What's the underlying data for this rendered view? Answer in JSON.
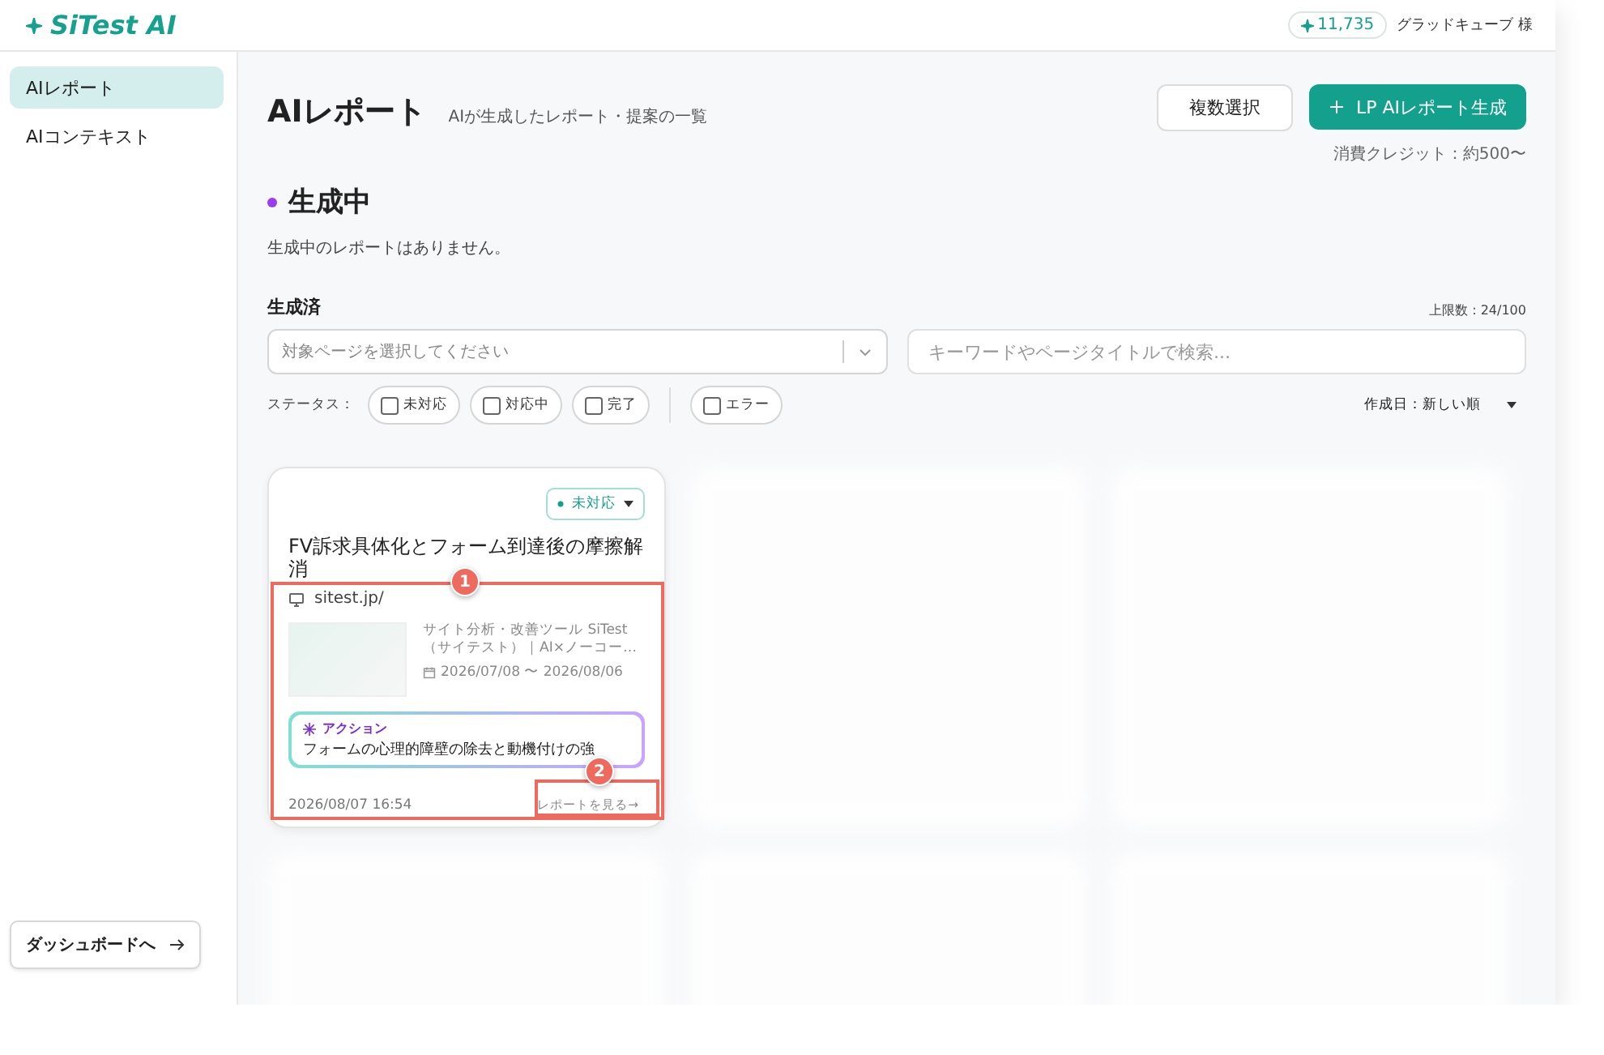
{
  "header": {
    "logo": "SiTest AI",
    "credits": "11,735",
    "user": "グラッドキューブ 様"
  },
  "sidebar": {
    "items": [
      {
        "label": "AIレポート",
        "selected": true
      },
      {
        "label": "AIコンテキスト",
        "selected": false
      }
    ],
    "dashboard_button": "ダッシュボードへ"
  },
  "page": {
    "title": "AIレポート",
    "subtitle": "AIが生成したレポート・提案の一覧",
    "multi_select_button": "複数選択",
    "generate_button": "LP AIレポート生成",
    "credit_note": "消費クレジット：約500〜"
  },
  "generating": {
    "heading": "生成中",
    "empty_message": "生成中のレポートはありません。"
  },
  "generated": {
    "heading": "生成済",
    "limit": "上限数 : 24/100",
    "page_select": {
      "placeholder": "対象ページを選択してください"
    },
    "search": {
      "placeholder": "キーワードやページタイトルで検索..."
    },
    "status_label": "ステータス：",
    "filters": [
      {
        "label": "未対応",
        "checked": false
      },
      {
        "label": "対応中",
        "checked": false
      },
      {
        "label": "完了",
        "checked": false
      }
    ],
    "error_filters": [
      {
        "label": "エラー",
        "checked": false
      }
    ],
    "sort": "作成日：新しい順"
  },
  "cards": [
    {
      "kind": "report",
      "status": "未対応",
      "title": "FV訴求具体化とフォーム到達後の摩擦解消",
      "url": "sitest.jp/",
      "page_title": "サイト分析・改善ツール SiTest（サイテスト）｜AI×ノーコー…",
      "period": "2026/07/08 〜 2026/08/06",
      "action_label": "アクション",
      "action_text": "フォームの心理的障壁の除去と動機付けの強",
      "created": "2026/08/07 16:54",
      "link": "レポートを見る→"
    },
    {
      "kind": "blurred"
    },
    {
      "kind": "blurred"
    },
    {
      "kind": "blurred"
    },
    {
      "kind": "blurred"
    },
    {
      "kind": "blurred"
    }
  ],
  "annotations": [
    {
      "number": "1"
    },
    {
      "number": "2"
    }
  ]
}
